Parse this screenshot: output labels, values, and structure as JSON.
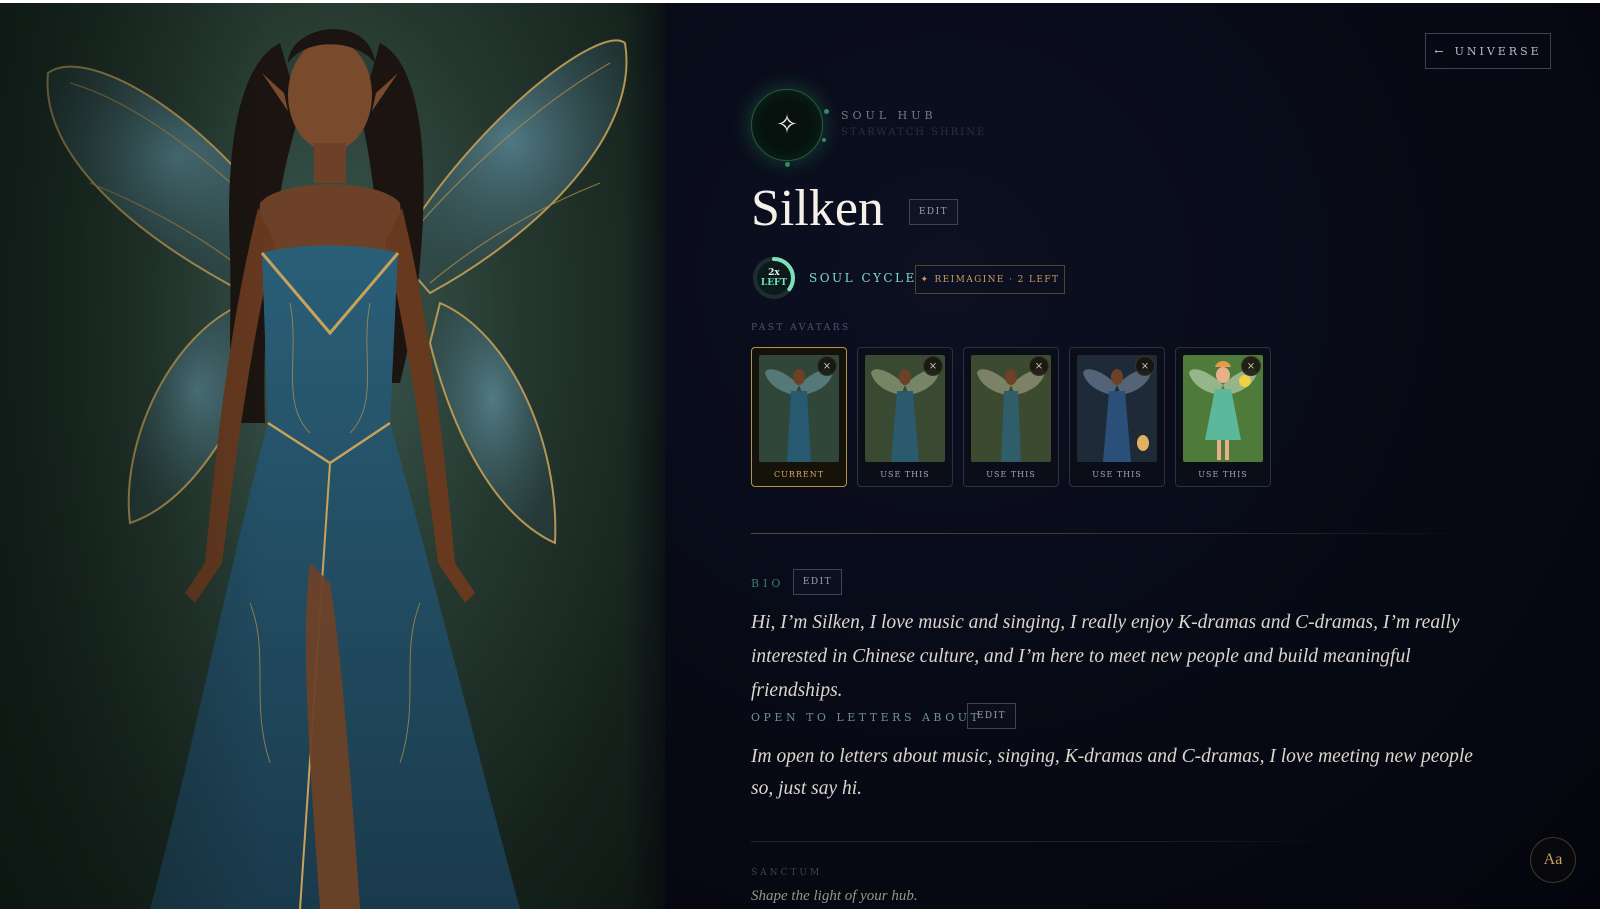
{
  "nav": {
    "back_label": "UNIVERSE",
    "back_icon": "←"
  },
  "hub": {
    "title": "SOUL HUB",
    "subtitle": "STARWATCH SHRINE",
    "sigil_icon": "✧"
  },
  "profile": {
    "name": "Silken",
    "edit_label": "EDIT",
    "soul_cycle": {
      "count": "2x",
      "count_sub": "LEFT",
      "label": "SOUL CYCLE",
      "fraction_remaining": 0.35
    },
    "reimagine": {
      "icon": "✦",
      "label": "REIMAGINE · 2 LEFT"
    }
  },
  "past_avatars": {
    "label": "PAST AVATARS",
    "items": [
      {
        "caption": "CURRENT",
        "close": "×",
        "palette": "teal"
      },
      {
        "caption": "USE THIS",
        "close": "×",
        "palette": "teal"
      },
      {
        "caption": "USE THIS",
        "close": "×",
        "palette": "teal"
      },
      {
        "caption": "USE THIS",
        "close": "×",
        "palette": "navy"
      },
      {
        "caption": "USE THIS",
        "close": "×",
        "palette": "green"
      }
    ]
  },
  "bio": {
    "label": "BIO",
    "edit_label": "EDIT",
    "text": "Hi, I’m Silken, I love music and singing, I really enjoy K-dramas and C-dramas, I’m really interested in Chinese culture, and I’m here to meet new people and build meaningful friendships."
  },
  "letters": {
    "label": "OPEN TO LETTERS ABOUT",
    "edit_label": "EDIT",
    "text": "Im open to letters about music, singing, K-dramas and C-dramas, I love meeting new people so, just say hi."
  },
  "sanctum": {
    "label": "SANCTUM",
    "text": "Shape the light of your hub."
  },
  "font_button": {
    "label": "Aa"
  },
  "colors": {
    "accent_gold": "#c89e58",
    "accent_teal": "#7fd8cc",
    "accent_green": "#2c8e58",
    "background": "#05060f"
  }
}
